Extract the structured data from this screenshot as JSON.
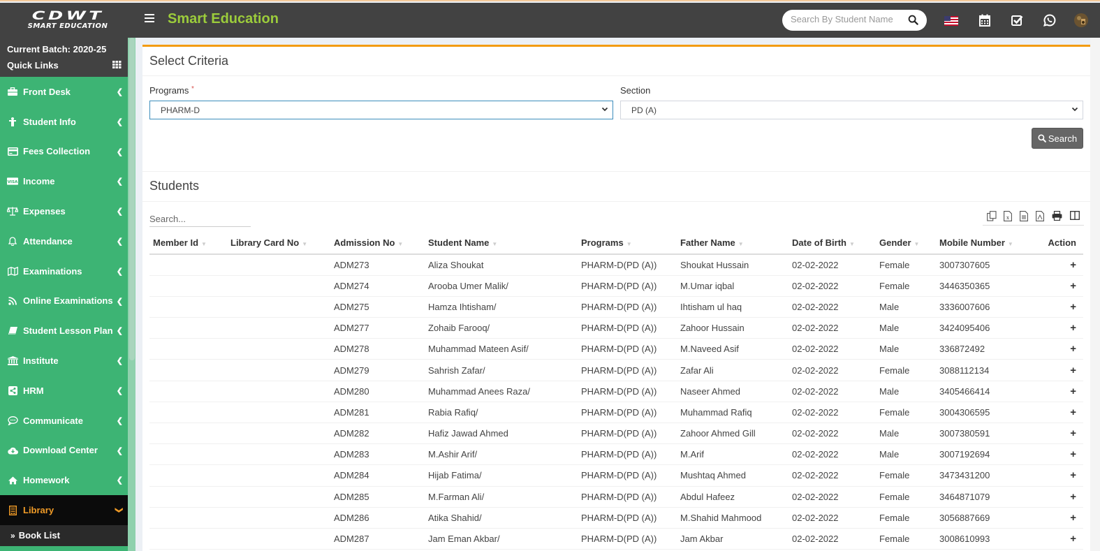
{
  "header": {
    "logo_line1": "CDWT",
    "logo_line2": "SMART EDUCATION",
    "app_title": "Smart Education",
    "search_placeholder": "Search By Student Name",
    "icons": [
      "search-icon",
      "us-flag-icon",
      "calendar-icon",
      "checkbox-icon",
      "whatsapp-icon",
      "user-avatar"
    ]
  },
  "sidebar": {
    "batch_label": "Current Batch: 2020-25",
    "quick_links_label": "Quick Links",
    "items": [
      {
        "label": "Front Desk",
        "icon": "briefcase-icon"
      },
      {
        "label": "Student Info",
        "icon": "student-icon"
      },
      {
        "label": "Fees Collection",
        "icon": "credit-card-icon"
      },
      {
        "label": "Income",
        "icon": "visa-icon"
      },
      {
        "label": "Expenses",
        "icon": "balance-scale-icon"
      },
      {
        "label": "Attendance",
        "icon": "bell-icon"
      },
      {
        "label": "Examinations",
        "icon": "map-icon"
      },
      {
        "label": "Online Examinations",
        "icon": "rss-icon"
      },
      {
        "label": "Student Lesson Plan",
        "icon": "book-icon"
      },
      {
        "label": "Institute",
        "icon": "institution-icon"
      },
      {
        "label": "HRM",
        "icon": "share-icon"
      },
      {
        "label": "Communicate",
        "icon": "comment-icon"
      },
      {
        "label": "Download Center",
        "icon": "cloud-download-icon"
      },
      {
        "label": "Homework",
        "icon": "home-icon"
      },
      {
        "label": "Library",
        "icon": "library-book-icon",
        "active": true
      }
    ],
    "sub_items": [
      {
        "label": "Book List"
      }
    ],
    "active_color": "#f09b27",
    "bg_color": "#3db474"
  },
  "criteria": {
    "title": "Select Criteria",
    "programs_label": "Programs",
    "required_mark": "*",
    "programs_value": "PHARM-D",
    "section_label": "Section",
    "section_value": "PD (A)",
    "search_button": "Search"
  },
  "students": {
    "title": "Students",
    "search_placeholder": "Search...",
    "export_icons": [
      "copy-icon",
      "excel-icon",
      "csv-icon",
      "pdf-icon",
      "print-icon",
      "columns-icon"
    ],
    "columns": [
      "Member Id",
      "Library Card No",
      "Admission No",
      "Student Name",
      "Programs",
      "Father Name",
      "Date of Birth",
      "Gender",
      "Mobile Number",
      "Action"
    ],
    "rows": [
      {
        "member_id": "",
        "card_no": "",
        "admission_no": "ADM273",
        "name": "Aliza Shoukat",
        "program": "PHARM-D(PD (A))",
        "father": "Shoukat Hussain",
        "dob": "02-02-2022",
        "gender": "Female",
        "mobile": "3007307605",
        "action": "+"
      },
      {
        "member_id": "",
        "card_no": "",
        "admission_no": "ADM274",
        "name": "Arooba Umer Malik/",
        "program": "PHARM-D(PD (A))",
        "father": "M.Umar iqbal",
        "dob": "02-02-2022",
        "gender": "Female",
        "mobile": "3446350365",
        "action": "+"
      },
      {
        "member_id": "",
        "card_no": "",
        "admission_no": "ADM275",
        "name": "Hamza Ihtisham/",
        "program": "PHARM-D(PD (A))",
        "father": "Ihtisham ul haq",
        "dob": "02-02-2022",
        "gender": "Male",
        "mobile": "3336007606",
        "action": "+"
      },
      {
        "member_id": "",
        "card_no": "",
        "admission_no": "ADM277",
        "name": "Zohaib Farooq/",
        "program": "PHARM-D(PD (A))",
        "father": "Zahoor Hussain",
        "dob": "02-02-2022",
        "gender": "Male",
        "mobile": "3424095406",
        "action": "+"
      },
      {
        "member_id": "",
        "card_no": "",
        "admission_no": "ADM278",
        "name": "Muhammad Mateen Asif/",
        "program": "PHARM-D(PD (A))",
        "father": "M.Naveed Asif",
        "dob": "02-02-2022",
        "gender": "Male",
        "mobile": "336872492",
        "action": "+"
      },
      {
        "member_id": "",
        "card_no": "",
        "admission_no": "ADM279",
        "name": "Sahrish Zafar/",
        "program": "PHARM-D(PD (A))",
        "father": "Zafar Ali",
        "dob": "02-02-2022",
        "gender": "Female",
        "mobile": "3088112134",
        "action": "+"
      },
      {
        "member_id": "",
        "card_no": "",
        "admission_no": "ADM280",
        "name": "Muhammad Anees Raza/",
        "program": "PHARM-D(PD (A))",
        "father": "Naseer Ahmed",
        "dob": "02-02-2022",
        "gender": "Male",
        "mobile": "3405466414",
        "action": "+"
      },
      {
        "member_id": "",
        "card_no": "",
        "admission_no": "ADM281",
        "name": "Rabia Rafiq/",
        "program": "PHARM-D(PD (A))",
        "father": "Muhammad Rafiq",
        "dob": "02-02-2022",
        "gender": "Female",
        "mobile": "3004306595",
        "action": "+"
      },
      {
        "member_id": "",
        "card_no": "",
        "admission_no": "ADM282",
        "name": "Hafiz Jawad Ahmed",
        "program": "PHARM-D(PD (A))",
        "father": "Zahoor Ahmed Gill",
        "dob": "02-02-2022",
        "gender": "Male",
        "mobile": "3007380591",
        "action": "+"
      },
      {
        "member_id": "",
        "card_no": "",
        "admission_no": "ADM283",
        "name": "M.Ashir Arif/",
        "program": "PHARM-D(PD (A))",
        "father": "M.Arif",
        "dob": "02-02-2022",
        "gender": "Male",
        "mobile": "3007192694",
        "action": "+"
      },
      {
        "member_id": "",
        "card_no": "",
        "admission_no": "ADM284",
        "name": "Hijab Fatima/",
        "program": "PHARM-D(PD (A))",
        "father": "Mushtaq Ahmed",
        "dob": "02-02-2022",
        "gender": "Female",
        "mobile": "3473431200",
        "action": "+"
      },
      {
        "member_id": "",
        "card_no": "",
        "admission_no": "ADM285",
        "name": "M.Farman Ali/",
        "program": "PHARM-D(PD (A))",
        "father": "Abdul Hafeez",
        "dob": "02-02-2022",
        "gender": "Female",
        "mobile": "3464871079",
        "action": "+"
      },
      {
        "member_id": "",
        "card_no": "",
        "admission_no": "ADM286",
        "name": "Atika Shahid/",
        "program": "PHARM-D(PD (A))",
        "father": "M.Shahid Mahmood",
        "dob": "02-02-2022",
        "gender": "Female",
        "mobile": "3056887669",
        "action": "+"
      },
      {
        "member_id": "",
        "card_no": "",
        "admission_no": "ADM287",
        "name": "Jam Eman Akbar/",
        "program": "PHARM-D(PD (A))",
        "father": "Jam Akbar",
        "dob": "02-02-2022",
        "gender": "Female",
        "mobile": "3008610993",
        "action": "+"
      }
    ]
  }
}
